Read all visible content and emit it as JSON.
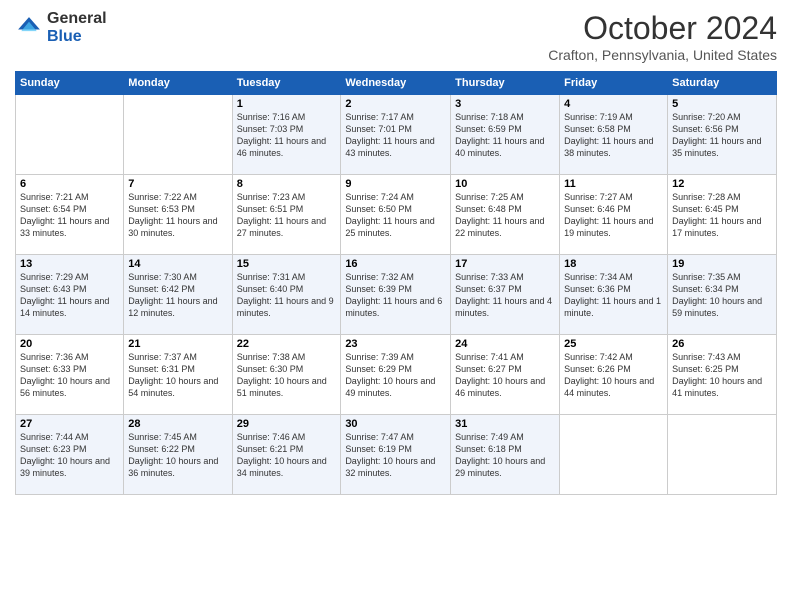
{
  "logo": {
    "line1": "General",
    "line2": "Blue"
  },
  "title": "October 2024",
  "location": "Crafton, Pennsylvania, United States",
  "days_header": [
    "Sunday",
    "Monday",
    "Tuesday",
    "Wednesday",
    "Thursday",
    "Friday",
    "Saturday"
  ],
  "weeks": [
    [
      {
        "day": "",
        "sunrise": "",
        "sunset": "",
        "daylight": ""
      },
      {
        "day": "",
        "sunrise": "",
        "sunset": "",
        "daylight": ""
      },
      {
        "day": "1",
        "sunrise": "Sunrise: 7:16 AM",
        "sunset": "Sunset: 7:03 PM",
        "daylight": "Daylight: 11 hours and 46 minutes."
      },
      {
        "day": "2",
        "sunrise": "Sunrise: 7:17 AM",
        "sunset": "Sunset: 7:01 PM",
        "daylight": "Daylight: 11 hours and 43 minutes."
      },
      {
        "day": "3",
        "sunrise": "Sunrise: 7:18 AM",
        "sunset": "Sunset: 6:59 PM",
        "daylight": "Daylight: 11 hours and 40 minutes."
      },
      {
        "day": "4",
        "sunrise": "Sunrise: 7:19 AM",
        "sunset": "Sunset: 6:58 PM",
        "daylight": "Daylight: 11 hours and 38 minutes."
      },
      {
        "day": "5",
        "sunrise": "Sunrise: 7:20 AM",
        "sunset": "Sunset: 6:56 PM",
        "daylight": "Daylight: 11 hours and 35 minutes."
      }
    ],
    [
      {
        "day": "6",
        "sunrise": "Sunrise: 7:21 AM",
        "sunset": "Sunset: 6:54 PM",
        "daylight": "Daylight: 11 hours and 33 minutes."
      },
      {
        "day": "7",
        "sunrise": "Sunrise: 7:22 AM",
        "sunset": "Sunset: 6:53 PM",
        "daylight": "Daylight: 11 hours and 30 minutes."
      },
      {
        "day": "8",
        "sunrise": "Sunrise: 7:23 AM",
        "sunset": "Sunset: 6:51 PM",
        "daylight": "Daylight: 11 hours and 27 minutes."
      },
      {
        "day": "9",
        "sunrise": "Sunrise: 7:24 AM",
        "sunset": "Sunset: 6:50 PM",
        "daylight": "Daylight: 11 hours and 25 minutes."
      },
      {
        "day": "10",
        "sunrise": "Sunrise: 7:25 AM",
        "sunset": "Sunset: 6:48 PM",
        "daylight": "Daylight: 11 hours and 22 minutes."
      },
      {
        "day": "11",
        "sunrise": "Sunrise: 7:27 AM",
        "sunset": "Sunset: 6:46 PM",
        "daylight": "Daylight: 11 hours and 19 minutes."
      },
      {
        "day": "12",
        "sunrise": "Sunrise: 7:28 AM",
        "sunset": "Sunset: 6:45 PM",
        "daylight": "Daylight: 11 hours and 17 minutes."
      }
    ],
    [
      {
        "day": "13",
        "sunrise": "Sunrise: 7:29 AM",
        "sunset": "Sunset: 6:43 PM",
        "daylight": "Daylight: 11 hours and 14 minutes."
      },
      {
        "day": "14",
        "sunrise": "Sunrise: 7:30 AM",
        "sunset": "Sunset: 6:42 PM",
        "daylight": "Daylight: 11 hours and 12 minutes."
      },
      {
        "day": "15",
        "sunrise": "Sunrise: 7:31 AM",
        "sunset": "Sunset: 6:40 PM",
        "daylight": "Daylight: 11 hours and 9 minutes."
      },
      {
        "day": "16",
        "sunrise": "Sunrise: 7:32 AM",
        "sunset": "Sunset: 6:39 PM",
        "daylight": "Daylight: 11 hours and 6 minutes."
      },
      {
        "day": "17",
        "sunrise": "Sunrise: 7:33 AM",
        "sunset": "Sunset: 6:37 PM",
        "daylight": "Daylight: 11 hours and 4 minutes."
      },
      {
        "day": "18",
        "sunrise": "Sunrise: 7:34 AM",
        "sunset": "Sunset: 6:36 PM",
        "daylight": "Daylight: 11 hours and 1 minute."
      },
      {
        "day": "19",
        "sunrise": "Sunrise: 7:35 AM",
        "sunset": "Sunset: 6:34 PM",
        "daylight": "Daylight: 10 hours and 59 minutes."
      }
    ],
    [
      {
        "day": "20",
        "sunrise": "Sunrise: 7:36 AM",
        "sunset": "Sunset: 6:33 PM",
        "daylight": "Daylight: 10 hours and 56 minutes."
      },
      {
        "day": "21",
        "sunrise": "Sunrise: 7:37 AM",
        "sunset": "Sunset: 6:31 PM",
        "daylight": "Daylight: 10 hours and 54 minutes."
      },
      {
        "day": "22",
        "sunrise": "Sunrise: 7:38 AM",
        "sunset": "Sunset: 6:30 PM",
        "daylight": "Daylight: 10 hours and 51 minutes."
      },
      {
        "day": "23",
        "sunrise": "Sunrise: 7:39 AM",
        "sunset": "Sunset: 6:29 PM",
        "daylight": "Daylight: 10 hours and 49 minutes."
      },
      {
        "day": "24",
        "sunrise": "Sunrise: 7:41 AM",
        "sunset": "Sunset: 6:27 PM",
        "daylight": "Daylight: 10 hours and 46 minutes."
      },
      {
        "day": "25",
        "sunrise": "Sunrise: 7:42 AM",
        "sunset": "Sunset: 6:26 PM",
        "daylight": "Daylight: 10 hours and 44 minutes."
      },
      {
        "day": "26",
        "sunrise": "Sunrise: 7:43 AM",
        "sunset": "Sunset: 6:25 PM",
        "daylight": "Daylight: 10 hours and 41 minutes."
      }
    ],
    [
      {
        "day": "27",
        "sunrise": "Sunrise: 7:44 AM",
        "sunset": "Sunset: 6:23 PM",
        "daylight": "Daylight: 10 hours and 39 minutes."
      },
      {
        "day": "28",
        "sunrise": "Sunrise: 7:45 AM",
        "sunset": "Sunset: 6:22 PM",
        "daylight": "Daylight: 10 hours and 36 minutes."
      },
      {
        "day": "29",
        "sunrise": "Sunrise: 7:46 AM",
        "sunset": "Sunset: 6:21 PM",
        "daylight": "Daylight: 10 hours and 34 minutes."
      },
      {
        "day": "30",
        "sunrise": "Sunrise: 7:47 AM",
        "sunset": "Sunset: 6:19 PM",
        "daylight": "Daylight: 10 hours and 32 minutes."
      },
      {
        "day": "31",
        "sunrise": "Sunrise: 7:49 AM",
        "sunset": "Sunset: 6:18 PM",
        "daylight": "Daylight: 10 hours and 29 minutes."
      },
      {
        "day": "",
        "sunrise": "",
        "sunset": "",
        "daylight": ""
      },
      {
        "day": "",
        "sunrise": "",
        "sunset": "",
        "daylight": ""
      }
    ]
  ]
}
